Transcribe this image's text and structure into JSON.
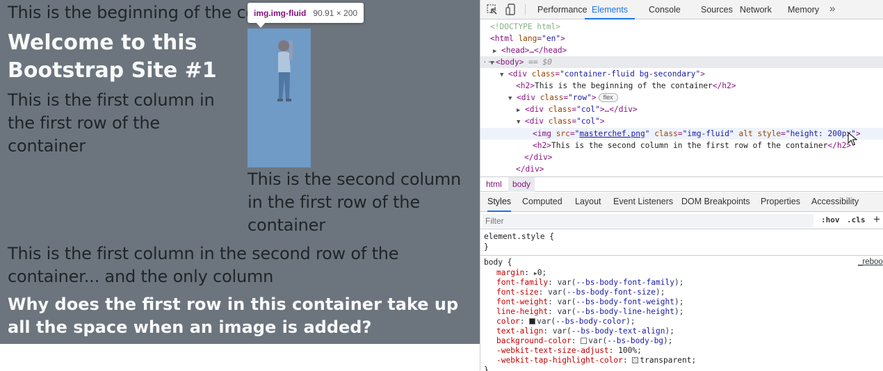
{
  "page": {
    "container_heading": "This is the beginning of the container",
    "welcome": "Welcome to this Bootstrap Site #1",
    "col1_text": "This is the first column in the first row of the container",
    "col2_text": "This is the second column in the first row of the container",
    "row2_text": "This is the first column in the second row of the container... and the only column",
    "question": "Why does the first row in this container take up all the space when an image is added?",
    "tooltip": {
      "selector": "img.img-fluid",
      "size": "90.91 × 200"
    }
  },
  "devtools": {
    "tabs": [
      "Performance",
      "Elements",
      "Console",
      "Sources",
      "Network",
      "Memory"
    ],
    "active_tab": "Elements",
    "more_tabs": "»",
    "dom": {
      "doctype": "<!DOCTYPE html>",
      "html_open": "<html",
      "html_lang_attr": "lang",
      "html_lang_val": "\"en\"",
      "head": "<head>…</head>",
      "body_tag": "<body>",
      "body_eq": "== $0",
      "div_container_class": "\"container-fluid bg-secondary\"",
      "h2_text": "This is the beginning of the container",
      "row_class": "\"row\"",
      "flex_badge": "flex",
      "col_class": "\"col\"",
      "img_src": "masterchef.png",
      "img_class": "\"img-fluid\"",
      "img_style": "\"height: 200px\"",
      "h2b_text": "This is the second column in the first row of the container"
    },
    "breadcrumbs": [
      "html",
      "body"
    ],
    "sub_tabs": [
      "Styles",
      "Computed",
      "Layout",
      "Event Listeners",
      "DOM Breakpoints",
      "Properties",
      "Accessibility"
    ],
    "filter_placeholder": "Filter",
    "hov": ":hov",
    "cls": ".cls",
    "plus": "+",
    "styles": {
      "element_style": "element.style {",
      "close": "}",
      "body_selector": "body {",
      "source": "_reboo",
      "props": [
        {
          "name": "margin",
          "value": "0"
        },
        {
          "name": "font-family",
          "value": "--bs-body-font-family"
        },
        {
          "name": "font-size",
          "value": "--bs-body-font-size"
        },
        {
          "name": "font-weight",
          "value": "--bs-body-font-weight"
        },
        {
          "name": "line-height",
          "value": "--bs-body-line-height"
        },
        {
          "name": "color",
          "value": "--bs-body-color"
        },
        {
          "name": "text-align",
          "value": "--bs-body-text-align"
        },
        {
          "name": "background-color",
          "value": "--bs-body-bg"
        },
        {
          "name": "-webkit-text-size-adjust",
          "value": "100%"
        },
        {
          "name": "-webkit-tap-highlight-color",
          "value": "transparent"
        }
      ]
    }
  }
}
